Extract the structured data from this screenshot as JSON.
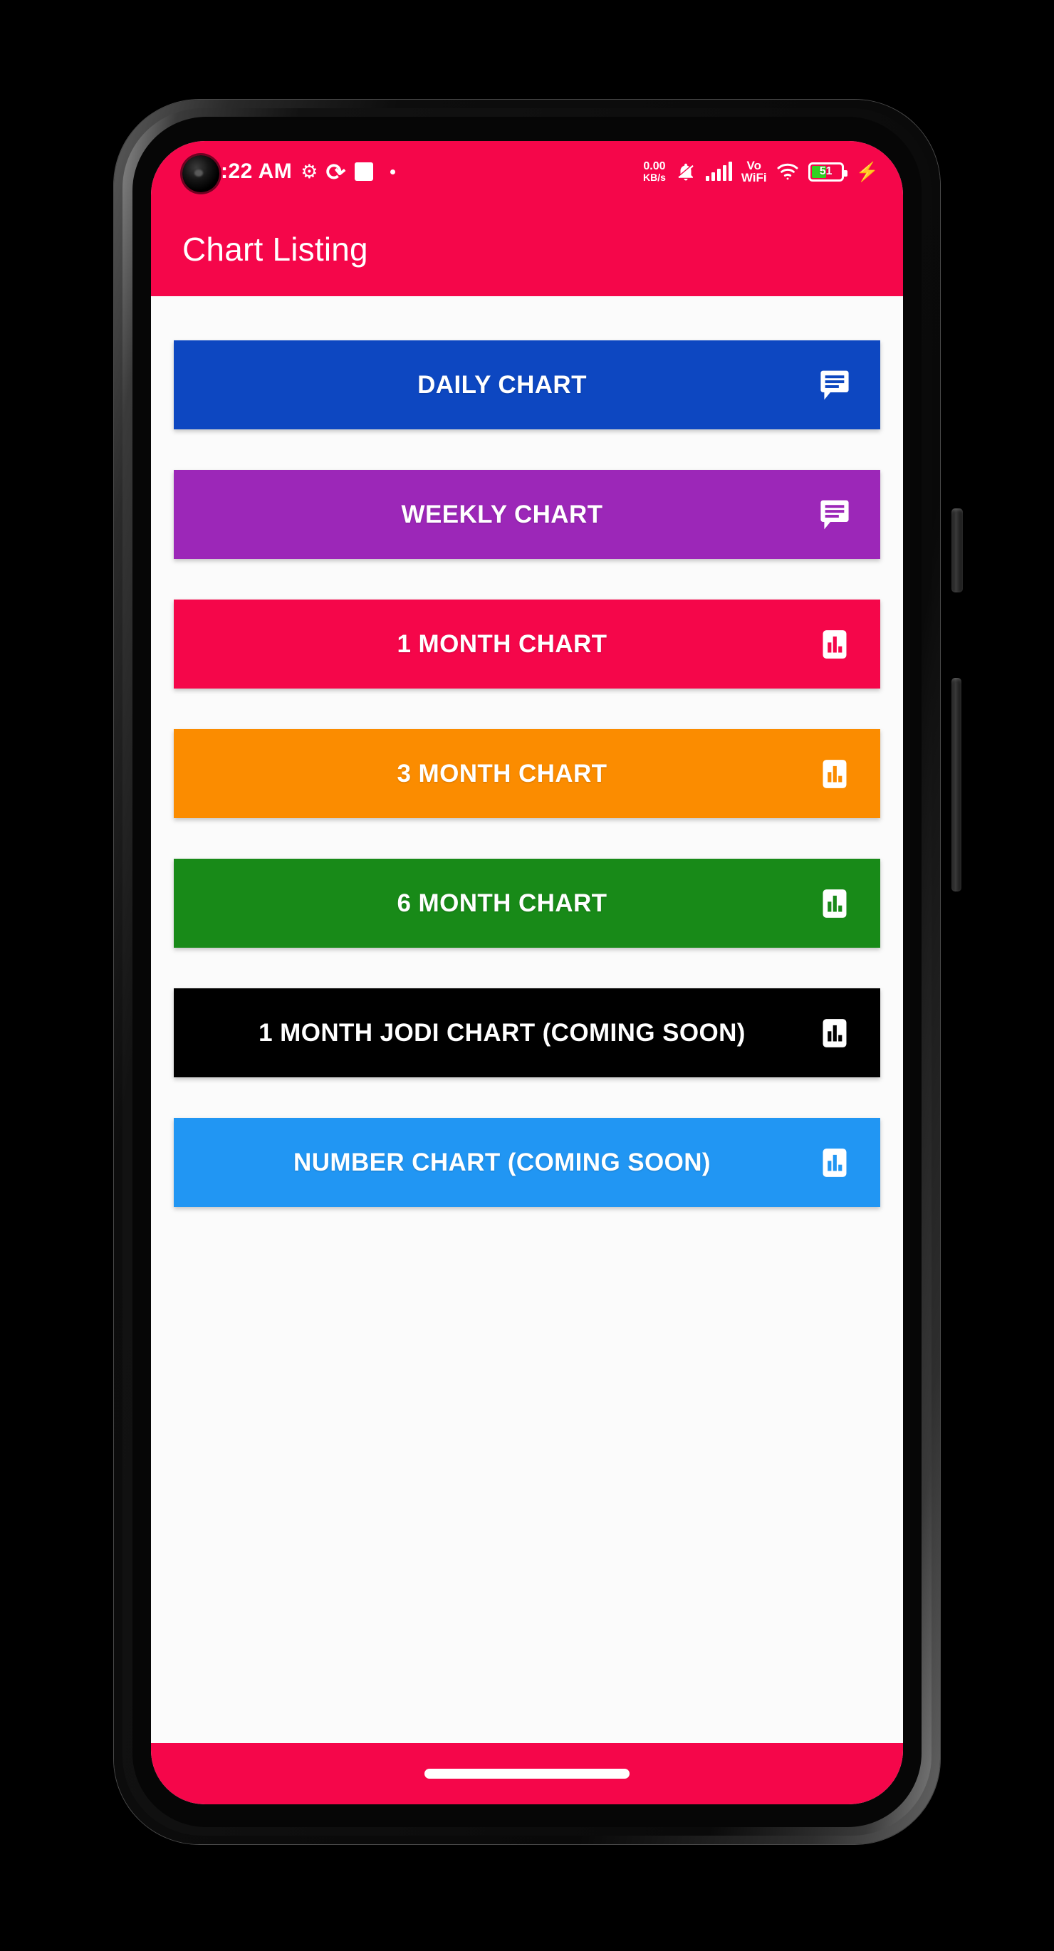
{
  "status_bar": {
    "time": ":22 AM",
    "gear_icon": "gear-icon",
    "swirl_icon": "swirl-icon",
    "square_icon": "square-icon",
    "dot_icon": "dot-icon",
    "net_speed_value": "0.00",
    "net_speed_unit": "KB/s",
    "bell_mute_icon": "bell-mute-icon",
    "signal_icon": "signal-bars-icon",
    "vo_line1": "Vo",
    "vo_line2": "WiFi",
    "wifi_icon": "wifi-icon",
    "battery_level": "51",
    "battery_percent": 51,
    "charging_icon": "charging-bolt-icon"
  },
  "app_bar": {
    "title": "Chart Listing"
  },
  "colors": {
    "brand": "#f5064a",
    "daily": "#0d47c1",
    "weekly": "#9c27b8",
    "one_month": "#f5064a",
    "three_month": "#fb8c00",
    "six_month": "#188a18",
    "jodi": "#000000",
    "number": "#2196f3",
    "screen_bg": "#fbfbfb"
  },
  "buttons": [
    {
      "label": "DAILY CHART",
      "color": "#0d47c1",
      "icon": "chat-message-icon"
    },
    {
      "label": "WEEKLY CHART",
      "color": "#9c27b8",
      "icon": "chat-message-icon"
    },
    {
      "label": "1 MONTH CHART",
      "color": "#f5064a",
      "icon": "bar-chart-icon"
    },
    {
      "label": "3 MONTH CHART",
      "color": "#fb8c00",
      "icon": "bar-chart-icon"
    },
    {
      "label": "6 MONTH CHART",
      "color": "#188a18",
      "icon": "bar-chart-icon"
    },
    {
      "label": "1 MONTH JODI CHART (COMING SOON)",
      "color": "#000000",
      "icon": "bar-chart-icon"
    },
    {
      "label": "NUMBER CHART (COMING SOON)",
      "color": "#2196f3",
      "icon": "bar-chart-icon"
    }
  ],
  "nav_bar": {
    "gesture_pill": "gesture-home-pill"
  }
}
